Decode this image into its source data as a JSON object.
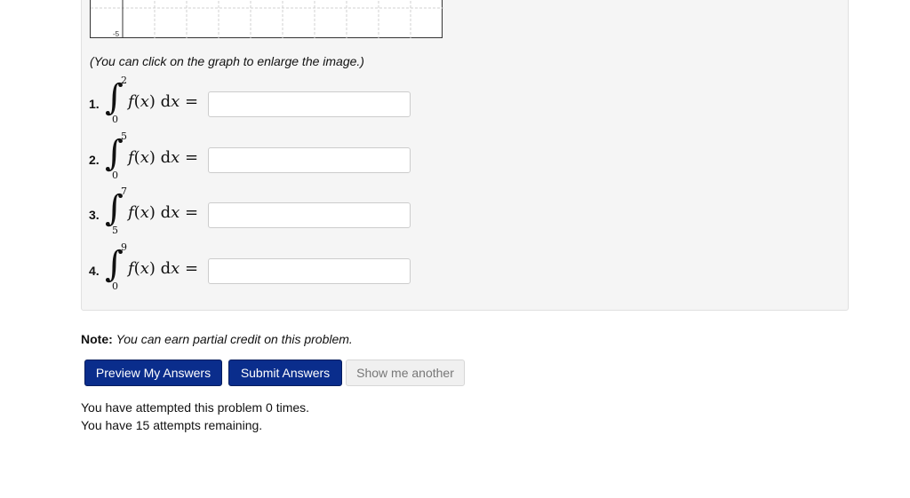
{
  "graph": {
    "tick_label": "-5",
    "note": "(You can click on the graph to enlarge the image.)"
  },
  "problems": [
    {
      "number": "1.",
      "lower": "0",
      "upper": "2",
      "integrand": "f",
      "variable": "x",
      "value": "",
      "placeholder": ""
    },
    {
      "number": "2.",
      "lower": "0",
      "upper": "5",
      "integrand": "f",
      "variable": "x",
      "value": "",
      "placeholder": ""
    },
    {
      "number": "3.",
      "lower": "5",
      "upper": "7",
      "integrand": "f",
      "variable": "x",
      "value": "",
      "placeholder": ""
    },
    {
      "number": "4.",
      "lower": "0",
      "upper": "9",
      "integrand": "f",
      "variable": "x",
      "value": "",
      "placeholder": ""
    }
  ],
  "note": {
    "label": "Note:",
    "text": "You can earn partial credit on this problem."
  },
  "buttons": {
    "preview": "Preview My Answers",
    "submit": "Submit Answers",
    "another": "Show me another"
  },
  "status": {
    "attempted": "You have attempted this problem 0 times.",
    "remaining": "You have 15 attempts remaining."
  },
  "colors": {
    "primary_button": "#0a2d8c",
    "panel_bg": "#f5f5f5"
  }
}
